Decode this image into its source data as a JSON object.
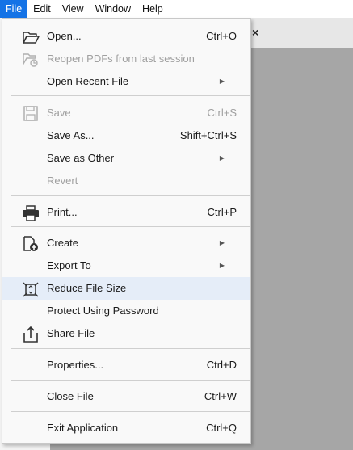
{
  "menubar": {
    "items": [
      "File",
      "Edit",
      "View",
      "Window",
      "Help"
    ]
  },
  "tab": {
    "close_glyph": "×"
  },
  "file_menu": {
    "open": {
      "label": "Open...",
      "shortcut": "Ctrl+O",
      "icon": "folder-open-icon"
    },
    "reopen": {
      "label": "Reopen PDFs from last session",
      "icon": "reopen-icon",
      "disabled": true
    },
    "open_recent": {
      "label": "Open Recent File",
      "submenu": true
    },
    "save": {
      "label": "Save",
      "shortcut": "Ctrl+S",
      "icon": "save-icon",
      "disabled": true
    },
    "save_as": {
      "label": "Save As...",
      "shortcut": "Shift+Ctrl+S"
    },
    "save_other": {
      "label": "Save as Other",
      "submenu": true
    },
    "revert": {
      "label": "Revert",
      "disabled": true
    },
    "print": {
      "label": "Print...",
      "shortcut": "Ctrl+P",
      "icon": "printer-icon"
    },
    "create": {
      "label": "Create",
      "submenu": true,
      "icon": "create-pdf-icon"
    },
    "export": {
      "label": "Export To",
      "submenu": true
    },
    "reduce": {
      "label": "Reduce File Size",
      "icon": "reduce-size-icon",
      "highlighted": true
    },
    "protect": {
      "label": "Protect Using Password"
    },
    "share": {
      "label": "Share File",
      "icon": "share-icon"
    },
    "properties": {
      "label": "Properties...",
      "shortcut": "Ctrl+D"
    },
    "close": {
      "label": "Close File",
      "shortcut": "Ctrl+W"
    },
    "exit": {
      "label": "Exit Application",
      "shortcut": "Ctrl+Q"
    }
  },
  "colors": {
    "accent": "#1473e6",
    "hover": "#e5edf8",
    "disabled_text": "#a0a0a0",
    "document_area": "#a6a6a6"
  }
}
